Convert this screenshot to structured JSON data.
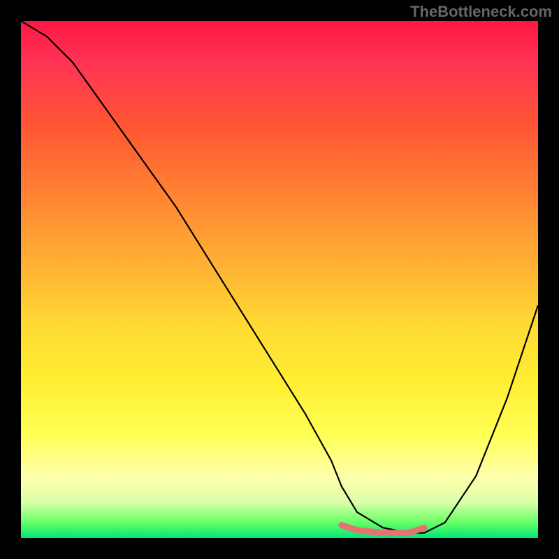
{
  "watermark": "TheBottleneck.com",
  "chart_data": {
    "type": "line",
    "title": "",
    "xlabel": "",
    "ylabel": "",
    "xlim": [
      0,
      100
    ],
    "ylim": [
      0,
      100
    ],
    "series": [
      {
        "name": "bottleneck-curve",
        "x": [
          0,
          5,
          10,
          15,
          20,
          25,
          30,
          35,
          40,
          45,
          50,
          55,
          60,
          62,
          65,
          70,
          75,
          78,
          82,
          88,
          94,
          100
        ],
        "values": [
          100,
          97,
          92,
          85,
          78,
          71,
          64,
          56,
          48,
          40,
          32,
          24,
          15,
          10,
          5,
          2,
          1,
          1,
          3,
          12,
          27,
          45
        ]
      },
      {
        "name": "optimal-range",
        "x": [
          62,
          65,
          70,
          75,
          78
        ],
        "values": [
          2.5,
          1.5,
          1.0,
          1.0,
          2.0
        ]
      }
    ],
    "gradient_stops": [
      {
        "pos": 0,
        "color": "#ff1744"
      },
      {
        "pos": 50,
        "color": "#ffdd33"
      },
      {
        "pos": 90,
        "color": "#ffffaa"
      },
      {
        "pos": 100,
        "color": "#00e676"
      }
    ],
    "pink_stroke": "#e57373"
  }
}
